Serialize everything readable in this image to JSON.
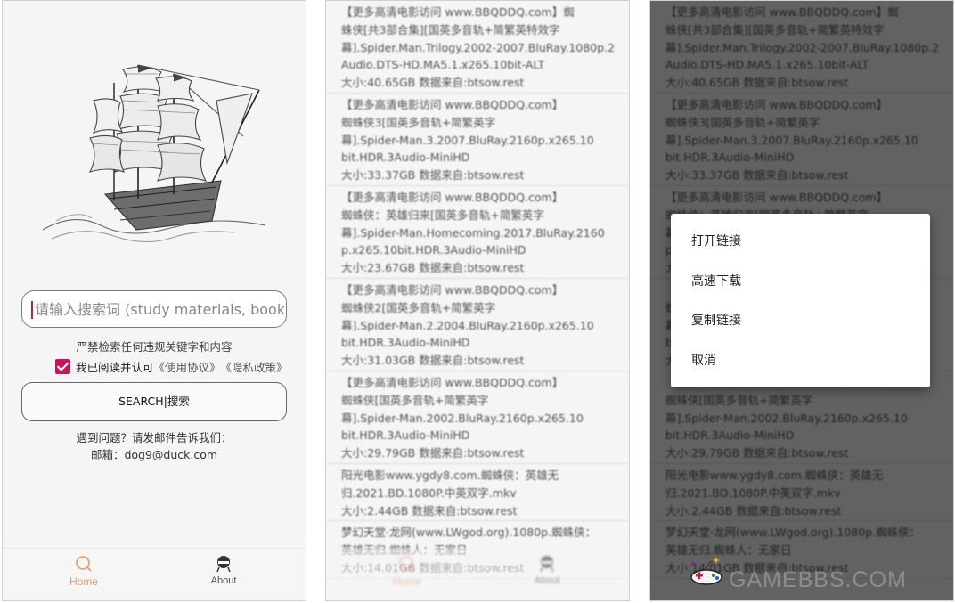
{
  "search": {
    "placeholder": "请输入搜索词 (study materials, books,",
    "warning": "严禁检索任何违规关键字和内容",
    "agree_text": "我已阅读并认可",
    "agree_terms": "《使用协议》",
    "agree_privacy": "《隐私政策》",
    "button_label": "SEARCH|搜索",
    "contact_line1": "遇到问题？请发邮件告诉我们：",
    "contact_line2": "邮箱：dog9@duck.com"
  },
  "nav": {
    "home_label": "Home",
    "about_label": "About"
  },
  "results": [
    {
      "lines": [
        "【更多高清电影访问 www.BBQDDQ.com】蜘",
        "蛛侠[共3部合集][国英多音轨+简繁英特效字",
        "幕].Spider.Man.Trilogy.2002-2007.BluRay.1080p.2",
        "Audio.DTS-HD.MA5.1.x265.10bit-ALT",
        "大小:40.65GB 数据来自:btsow.rest"
      ]
    },
    {
      "lines": [
        "【更多高清电影访问 www.BBQDDQ.com】",
        "蜘蛛侠3[国英多音轨+简繁英字",
        "幕].Spider-Man.3.2007.BluRay.2160p.x265.10",
        "bit.HDR.3Audio-MiniHD",
        "大小:33.37GB 数据来自:btsow.rest"
      ]
    },
    {
      "lines": [
        "【更多高清电影访问 www.BBQDDQ.com】",
        "蜘蛛侠：英雄归来[国英多音轨+简繁英字",
        "幕].Spider-Man.Homecoming.2017.BluRay.2160",
        "p.x265.10bit.HDR.3Audio-MiniHD",
        "大小:23.67GB 数据来自:btsow.rest"
      ]
    },
    {
      "lines": [
        "【更多高清电影访问 www.BBQDDQ.com】",
        "蜘蛛侠2[国英多音轨+简繁英字",
        "幕].Spider-Man.2.2004.BluRay.2160p.x265.10",
        "bit.HDR.3Audio-MiniHD",
        "大小:31.03GB 数据来自:btsow.rest"
      ]
    },
    {
      "lines": [
        "【更多高清电影访问 www.BBQDDQ.com】",
        "蜘蛛侠[国英多音轨+简繁英字",
        "幕].Spider-Man.2002.BluRay.2160p.x265.10",
        "bit.HDR.3Audio-MiniHD",
        "大小:29.79GB 数据来自:btsow.rest"
      ]
    },
    {
      "lines": [
        "阳光电影www.ygdy8.com.蜘蛛侠：英雄无",
        "归.2021.BD.1080P.中英双字.mkv",
        "大小:2.44GB 数据来自:btsow.rest"
      ]
    },
    {
      "lines": [
        "梦幻天堂·龙网(www.LWgod.org).1080p.蜘蛛侠：",
        "英雄无归.蜘蛛人：无家日",
        "大小:14.01GB 数据来自:btsow.rest"
      ]
    }
  ],
  "context_menu": {
    "items": [
      "打开链接",
      "高速下载",
      "复制链接",
      "取消"
    ]
  },
  "watermark": "GAMEBBS.COM",
  "colors": {
    "accent": "#c2185b",
    "nav_active": "#e89b6a"
  }
}
